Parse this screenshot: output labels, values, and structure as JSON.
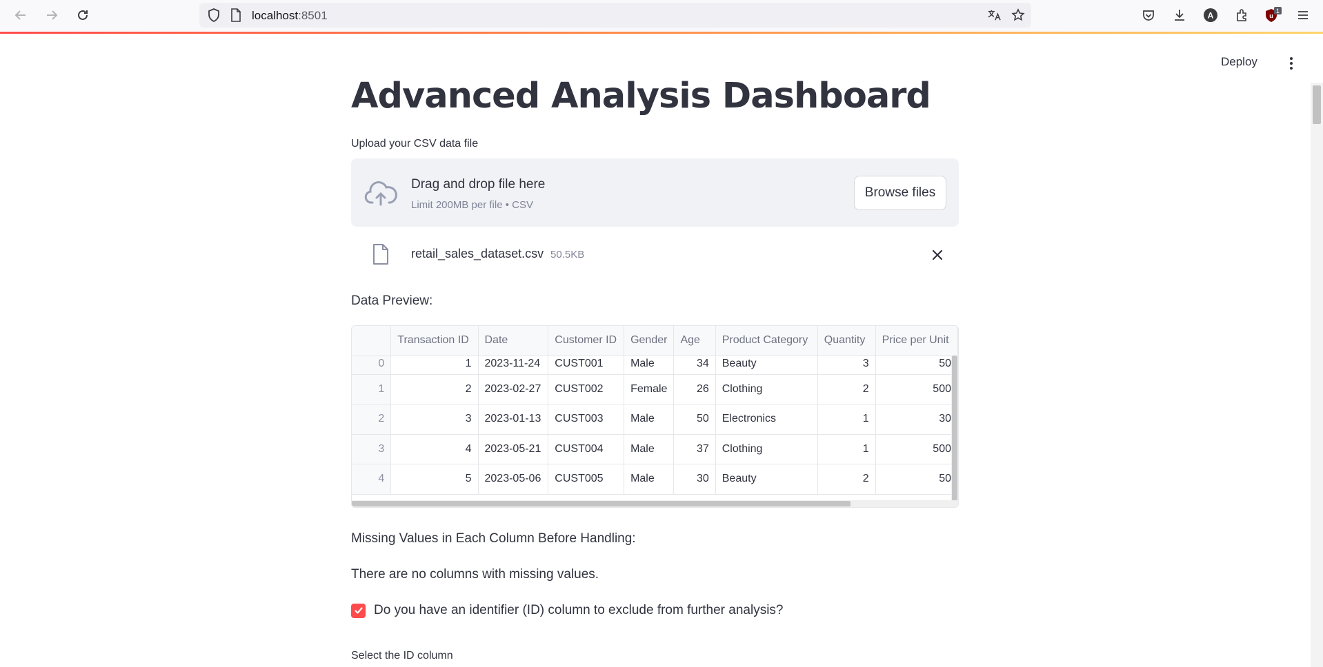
{
  "browser": {
    "url_host": "localhost",
    "url_port": ":8501",
    "extension_badge": "1"
  },
  "header": {
    "deploy_label": "Deploy"
  },
  "main": {
    "title": "Advanced Analysis Dashboard",
    "upload_label": "Upload your CSV data file",
    "dropzone": {
      "title": "Drag and drop file here",
      "subtitle": "Limit 200MB per file • CSV",
      "browse_label": "Browse files"
    },
    "file": {
      "name": "retail_sales_dataset.csv",
      "size": "50.5KB"
    },
    "preview_label": "Data Preview:",
    "dataframe": {
      "columns": [
        "",
        "Transaction ID",
        "Date",
        "Customer ID",
        "Gender",
        "Age",
        "Product Category",
        "Quantity",
        "Price per Unit"
      ],
      "rows": [
        [
          "0",
          "1",
          "2023-11-24",
          "CUST001",
          "Male",
          "34",
          "Beauty",
          "3",
          "50"
        ],
        [
          "1",
          "2",
          "2023-02-27",
          "CUST002",
          "Female",
          "26",
          "Clothing",
          "2",
          "500"
        ],
        [
          "2",
          "3",
          "2023-01-13",
          "CUST003",
          "Male",
          "50",
          "Electronics",
          "1",
          "30"
        ],
        [
          "3",
          "4",
          "2023-05-21",
          "CUST004",
          "Male",
          "37",
          "Clothing",
          "1",
          "500"
        ],
        [
          "4",
          "5",
          "2023-05-06",
          "CUST005",
          "Male",
          "30",
          "Beauty",
          "2",
          "50"
        ]
      ]
    },
    "missing_label": "Missing Values in Each Column Before Handling:",
    "missing_message": "There are no columns with missing values.",
    "id_checkbox": {
      "label": "Do you have an identifier (ID) column to exclude from further analysis?",
      "checked": true
    },
    "select_id_label": "Select the ID column"
  },
  "colors": {
    "accent": "#ff4b4b",
    "text": "#31333f",
    "muted": "#808495",
    "dropzone_bg": "#f0f2f6"
  }
}
